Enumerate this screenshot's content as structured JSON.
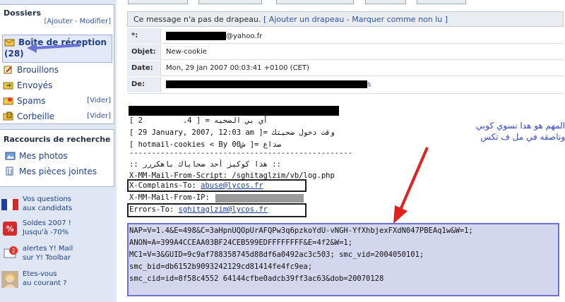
{
  "sidebar": {
    "title": "Dossiers",
    "actions": {
      "open": "[",
      "ajouter": "Ajouter",
      "sep": " - ",
      "modifier": "Modifier",
      "close": "]"
    },
    "folders": [
      {
        "label": "Boîte de réception",
        "count": "(28)",
        "icon": "inbox-icon"
      },
      {
        "label": "Brouillons",
        "icon": "draft-icon"
      },
      {
        "label": "Envoyés",
        "icon": "sent-icon"
      },
      {
        "label": "Spams",
        "action": "[Vider]",
        "icon": "spam-icon"
      },
      {
        "label": "Corbeille",
        "action": "[Vider]",
        "icon": "trash-icon"
      }
    ],
    "shortcuts_title": "Raccourcis de recherche",
    "shortcuts": [
      {
        "label": "Mes photos",
        "icon": "photo-icon"
      },
      {
        "label": "Mes pièces jointes",
        "icon": "attachment-icon"
      }
    ],
    "promos": [
      {
        "line1": "Vos questions",
        "line2": "aux candidats",
        "icon": "flag-icon"
      },
      {
        "line1": "Soldes 2007 !",
        "line2": "Jusqu'à -70%",
        "icon": "percent-icon"
      },
      {
        "line1": "alertes Y! Mail",
        "line2": "sur Y! Toolbar",
        "icon": "alert-icon"
      },
      {
        "line1": "Etes-vous",
        "line2": "au courant ?",
        "icon": "avatar-icon"
      }
    ]
  },
  "message": {
    "flag_text": "Ce message n'a pas de drapeau.",
    "flag_links": "[ Ajouter un drapeau - Marquer comme non lu ]",
    "headers": [
      {
        "label": "*:",
        "value": "@yahoo.fr"
      },
      {
        "label": "Objet:",
        "value": "New-cookie"
      },
      {
        "label": "Date:",
        "value": "Mon, 29 Jan 2007 00:03:41 +0100 (CET)"
      },
      {
        "label": "De:",
        "value": "s"
      }
    ],
    "body_lines": [
      "[ 2         .4 ] = آي بي الضحيه",
      "[ 29 January, 2007, 12:03 am ]= وقت دخول ضحيتك",
      "[ hotmail-cookies < By 00ش ]= صداع",
      "--------------------------------------------------",
      ":: هذا كوكيز أحد ضحاياك باهكررر ::",
      "X-MM-Mail-From-Script: /sghitaglzim/vb/log.php"
    ],
    "complains_label": "X-Complains-To: ",
    "complains_link": "abuse@lycos.fr",
    "from_ip": "X-MM-Mail-From-IP: ",
    "errors_label": "Errors-To: ",
    "errors_link": "sghitaglzim@lycos.fr",
    "cookie_lines": [
      "NAP=V=1.4&E=498&C=3aHpnUQOpUrAFQPw3q6pzkoYdU-vNGH-YfXhbjexFXdN047PBEAq1w&W=1;",
      "ANON=A=399A4CCEAA03BF24CEB599EDFFFFFFFF&E=4f2&W=1;",
      "MC1=V=3&GUID=9c9af788358745d88df6a0492ac3c503; smc_vid=2004050101;",
      "smc_bid=db6152b9093242129cd81414fe4fc9ea;",
      "smc_cid=id=8f58c4552 64144cfbe0adcb39ff3ac63&dob=20070128"
    ],
    "annotation_line1": "المهم هو هدا   نسوي كوبي",
    "annotation_line2": "وناصقه في مل ف تكس"
  },
  "colors": {
    "annotation_blue": "#3448d2",
    "arrow_red": "#e1201e",
    "arrow_blue": "#6d73d6",
    "link": "#2d51a6"
  }
}
